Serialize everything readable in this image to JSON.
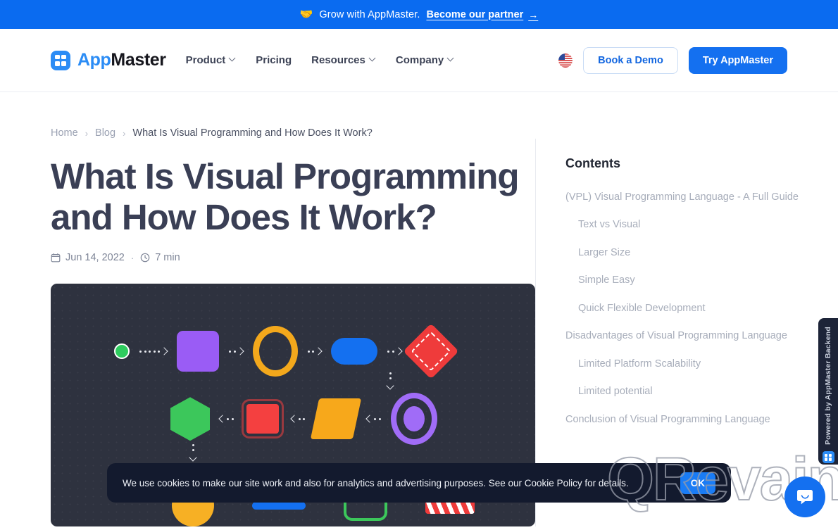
{
  "promo": {
    "emoji": "🤝",
    "icon": "handshake-icon",
    "text": "Grow with AppMaster.",
    "link": "Become our partner",
    "arrow": "→"
  },
  "header": {
    "logo": {
      "brand_first": "App",
      "brand_second": "Master",
      "icon": "appmaster-grid-logo"
    },
    "nav": [
      {
        "label": "Product",
        "has_dropdown": true
      },
      {
        "label": "Pricing",
        "has_dropdown": false
      },
      {
        "label": "Resources",
        "has_dropdown": true
      },
      {
        "label": "Company",
        "has_dropdown": true
      }
    ],
    "language_flag": "us-flag-icon",
    "demo_button": "Book a Demo",
    "cta_button": "Try AppMaster"
  },
  "breadcrumb": {
    "items": [
      "Home",
      "Blog",
      "What Is Visual Programming and How Does It Work?"
    ],
    "separator": "›"
  },
  "article": {
    "title": "What Is Visual Programming and How Does It Work?",
    "date": "Jun 14, 2022",
    "separator": "·",
    "read_time": "7 min",
    "date_icon": "calendar-icon",
    "time_icon": "clock-icon",
    "hero_alt": "visual-programming-flowchart"
  },
  "contents": {
    "heading": "Contents",
    "items": [
      {
        "label": "(VPL) Visual Programming Language - A Full Guide",
        "level": 1
      },
      {
        "label": "Text vs Visual",
        "level": 2
      },
      {
        "label": "Larger Size",
        "level": 2
      },
      {
        "label": "Simple Easy",
        "level": 2
      },
      {
        "label": "Quick Flexible Development",
        "level": 2
      },
      {
        "label": "Disadvantages of Visual Programming Language",
        "level": 1
      },
      {
        "label": "Limited Platform Scalability",
        "level": 2
      },
      {
        "label": "Limited potential",
        "level": 2
      },
      {
        "label": "Conclusion of Visual Programming Language",
        "level": 1
      }
    ]
  },
  "cookie_banner": {
    "text": "We use cookies to make our site work and also for analytics and advertising purposes. See our Cookie Policy for details.",
    "accept_label": "OK"
  },
  "powered_widget": {
    "label": "Powered by AppMaster Backend",
    "icon": "appmaster-grid-logo"
  },
  "watermark": {
    "text": "QRevain"
  },
  "chat_widget": {
    "icon": "chat-bubble-icon"
  },
  "colors": {
    "brand_blue": "#1470f0",
    "promo_blue": "#0a6bf0",
    "logo_blue": "#2b8cf5",
    "title_slate": "#3a3f55",
    "muted_grey": "#a7adba",
    "hero_dark": "#2e323f",
    "cookie_dark": "#131a2e"
  }
}
